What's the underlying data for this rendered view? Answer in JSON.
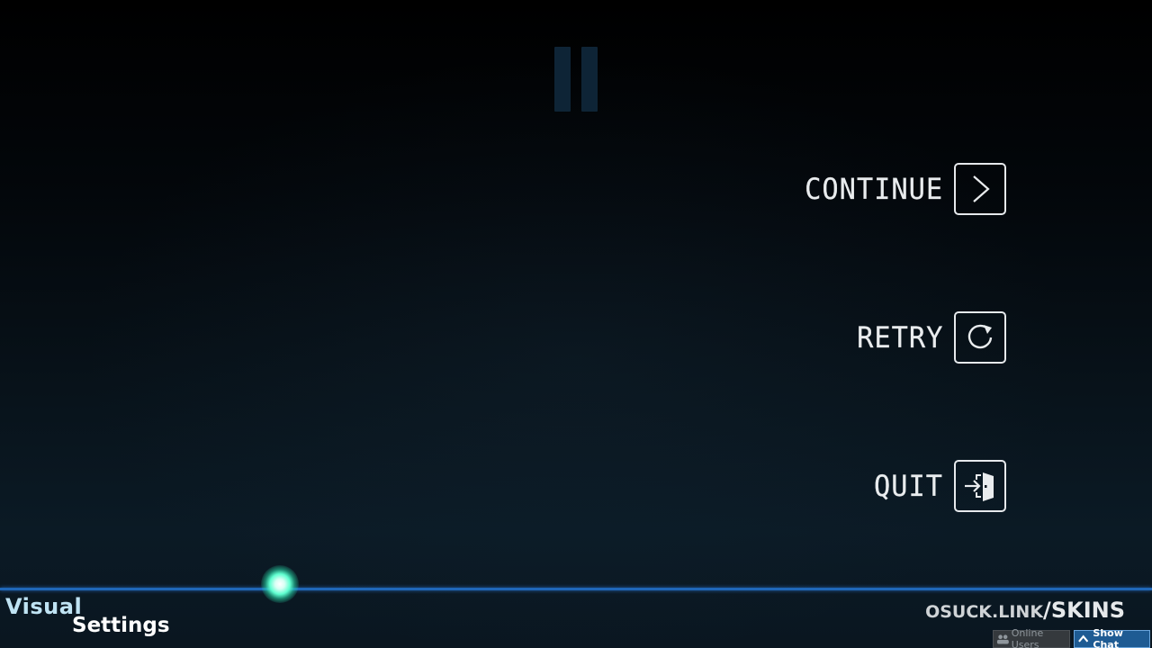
{
  "pause_menu": {
    "items": [
      {
        "label": "CONTINUE",
        "icon": "chevron-right-icon"
      },
      {
        "label": "RETRY",
        "icon": "retry-icon"
      },
      {
        "label": "QUIT",
        "icon": "exit-door-icon"
      }
    ]
  },
  "overlay": {
    "visual_settings": {
      "line1": "Visual",
      "line2": "Settings"
    },
    "watermark": {
      "left": "OSUCK.LINK",
      "right": "/SKINS"
    }
  },
  "bottom_bar": {
    "online_users_label": "Online Users",
    "show_chat_label": "Show Chat"
  },
  "colors": {
    "progress_line": "#1f67b8",
    "cursor_glow": "#5fffd0",
    "show_chat_bg": "#1e5b93",
    "pause_icon": "#0e2436"
  }
}
